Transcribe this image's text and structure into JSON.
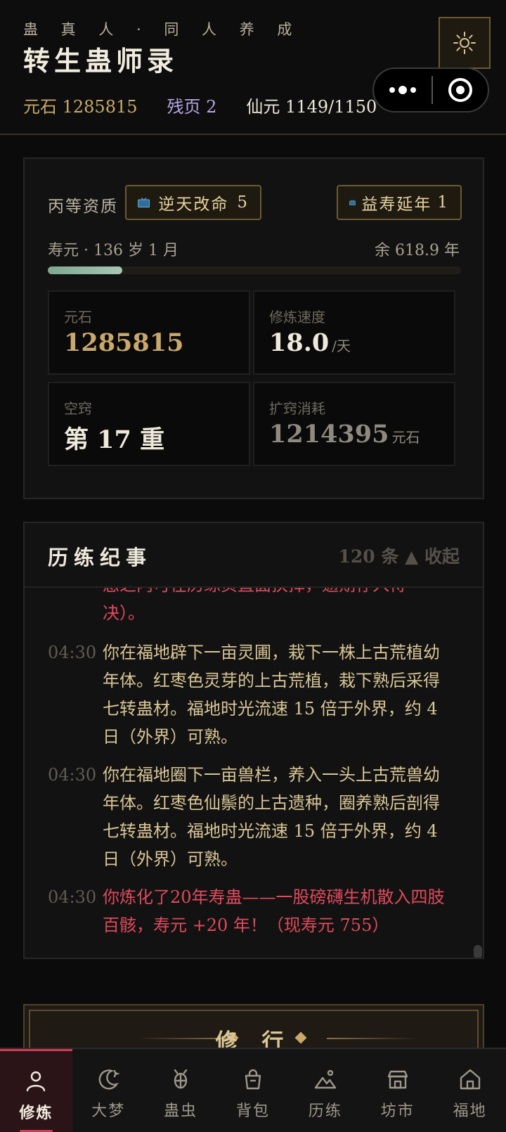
{
  "header": {
    "subtitle": "蛊 真 人 · 同 人 养 成",
    "title": "转生蛊师录",
    "resources": {
      "spirit_stone": "元石 1285815",
      "remnant_pages": "残页 2",
      "immortal_essence": "仙元 1149/1150"
    }
  },
  "status": {
    "aptitude": "丙等资质",
    "fate_button": {
      "label": "逆天改命",
      "count": "5",
      "icon": "tv-icon"
    },
    "life_button": {
      "label": "益寿延年",
      "count": "1",
      "icon": "tv-icon"
    },
    "lifespan_label": "寿元 · 136 岁 1 月",
    "lifespan_remaining": "余 618.9 年",
    "lifespan_progress_percent": 18,
    "stats": {
      "stone": {
        "label": "元石",
        "value": "1285815"
      },
      "speed": {
        "label": "修炼速度",
        "value": "18.0",
        "unit": "/天"
      },
      "aperture": {
        "label": "空窍",
        "value": "第 17 重"
      },
      "expand_cost": {
        "label": "扩窍消耗",
        "value": "1214395",
        "unit": "元石"
      }
    }
  },
  "log": {
    "title": "历练纪事",
    "toggle": "120 条 ▲ 收起",
    "partial_top": "急之内可在历练页直面抉择，逾期存入待",
    "partial_tail": "决）。",
    "entries": [
      {
        "time": "04:30",
        "text": "你在福地辟下一亩灵圃，栽下一株上古荒植幼年体。红枣色灵芽的上古荒植，栽下熟后采得七转蛊材。福地时光流速 15 倍于外界，约 4 日（外界）可熟。",
        "style": "gold"
      },
      {
        "time": "04:30",
        "text": "你在福地圈下一亩兽栏，养入一头上古荒兽幼年体。红枣色仙鬃的上古遗种，圈养熟后剖得七转蛊材。福地时光流速 15 倍于外界，约 4 日（外界）可熟。",
        "style": "gold"
      },
      {
        "time": "04:30",
        "text": "你炼化了20年寿蛊——一股磅礴生机散入四肢百骸，寿元 +20 年！（现寿元 755）",
        "style": "red"
      }
    ]
  },
  "practice_button": "修 行",
  "nav": [
    {
      "label": "修炼",
      "icon": "person-icon",
      "active": true
    },
    {
      "label": "大梦",
      "icon": "moon-icon",
      "active": false
    },
    {
      "label": "蛊虫",
      "icon": "bug-icon",
      "active": false
    },
    {
      "label": "背包",
      "icon": "bag-icon",
      "active": false
    },
    {
      "label": "历练",
      "icon": "mountain-icon",
      "active": false
    },
    {
      "label": "坊市",
      "icon": "shop-icon",
      "active": false
    },
    {
      "label": "福地",
      "icon": "home-icon",
      "active": false
    }
  ],
  "colors": {
    "gold": "#c9a86a",
    "purple": "#b7a6e3",
    "red": "#e04a5c",
    "progress": "#8fb59f",
    "background": "#0b0b0b"
  }
}
